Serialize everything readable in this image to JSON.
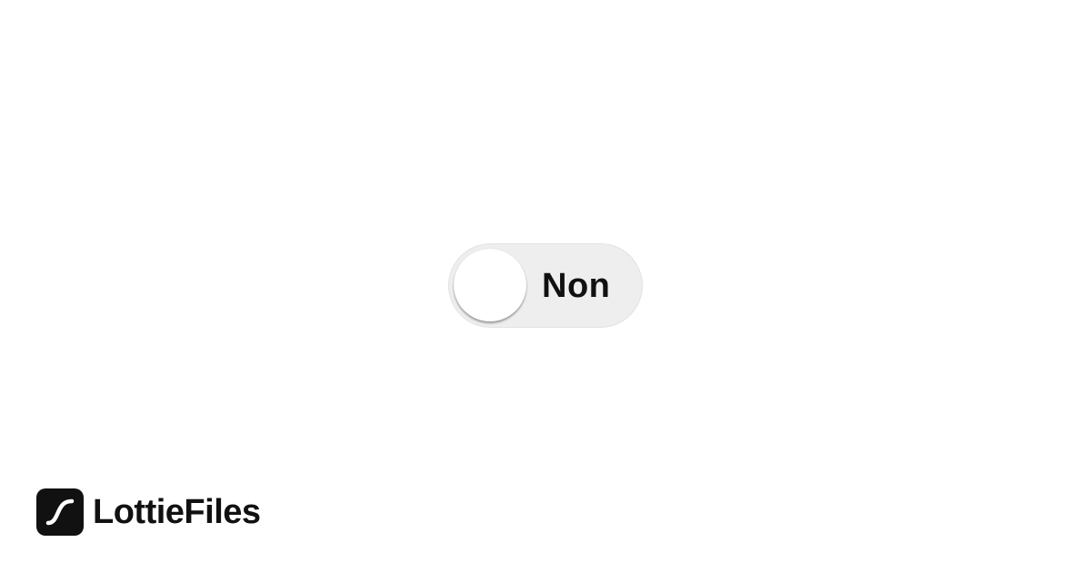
{
  "toggle": {
    "label": "Non",
    "state": "off",
    "track_color": "#eeeeee",
    "knob_color": "#ffffff"
  },
  "brand": {
    "name": "LottieFiles",
    "logo_icon": "lottiefiles-logo-icon",
    "color": "#111111"
  }
}
